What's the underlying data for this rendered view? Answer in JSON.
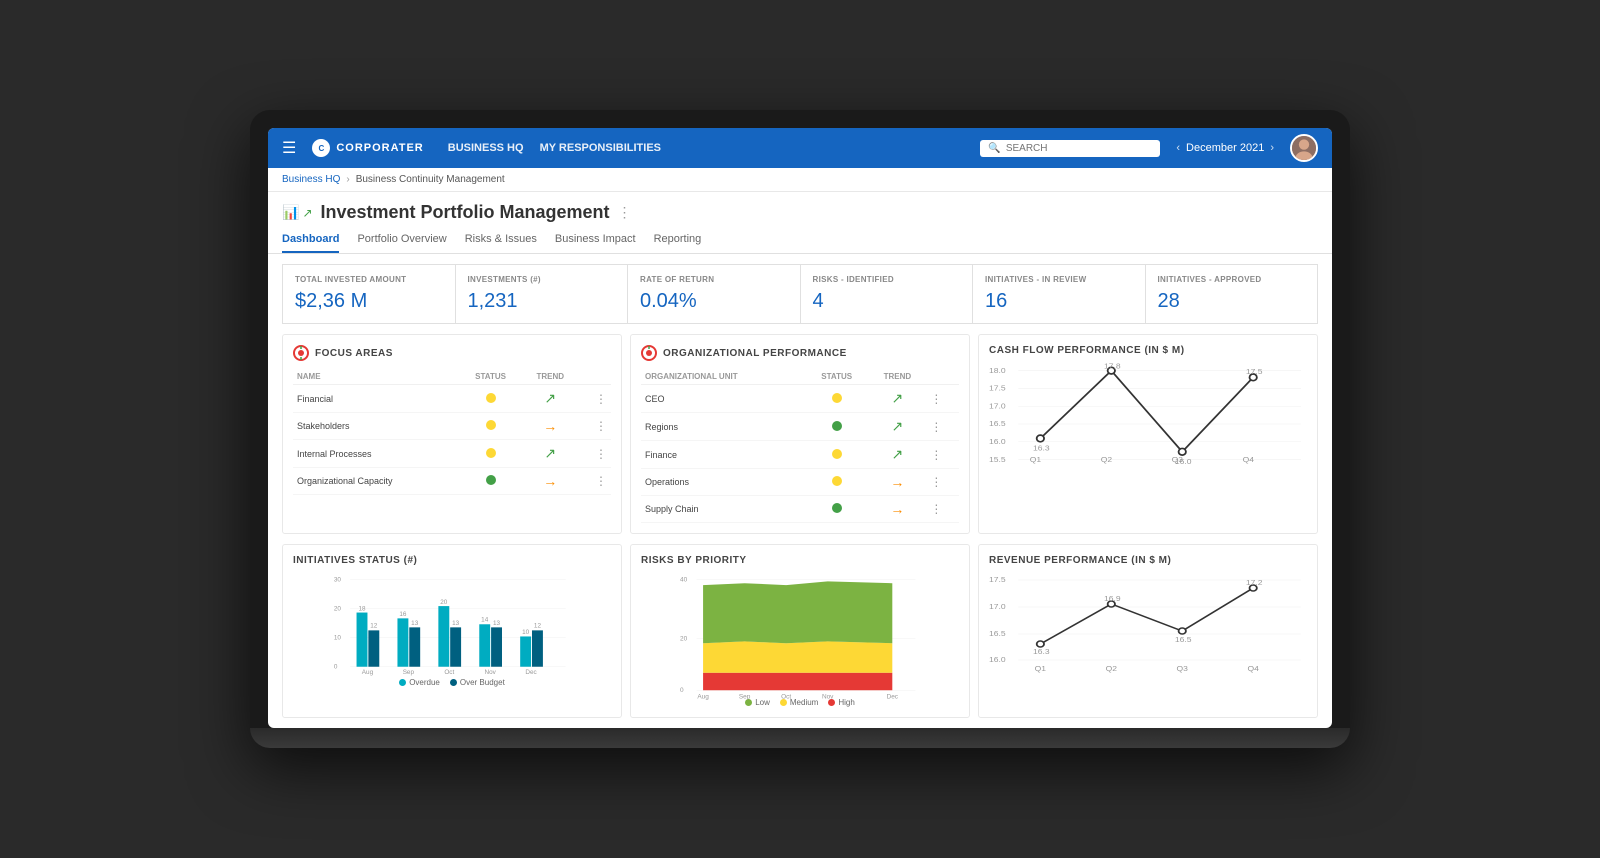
{
  "nav": {
    "hamburger": "☰",
    "logo_text": "CORPORATER",
    "links": [
      "BUSINESS HQ",
      "MY RESPONSIBILITIES"
    ],
    "search_placeholder": "SEARCH",
    "date": "December 2021",
    "prev_arrow": "‹",
    "next_arrow": "›"
  },
  "breadcrumb": {
    "root": "Business HQ",
    "sep": "›",
    "current": "Business Continuity Management"
  },
  "page": {
    "title": "Investment Portfolio Management",
    "more": "⋮"
  },
  "tabs": [
    {
      "label": "Dashboard",
      "active": true
    },
    {
      "label": "Portfolio Overview",
      "active": false
    },
    {
      "label": "Risks & Issues",
      "active": false
    },
    {
      "label": "Business Impact",
      "active": false
    },
    {
      "label": "Reporting",
      "active": false
    }
  ],
  "kpi_cards": [
    {
      "label": "TOTAL INVESTED AMOUNT",
      "value": "$2,36 M"
    },
    {
      "label": "INVESTMENTS (#)",
      "value": "1,231"
    },
    {
      "label": "RATE OF RETURN",
      "value": "0.04%"
    },
    {
      "label": "RISKS - IDENTIFIED",
      "value": "4"
    },
    {
      "label": "INITIATIVES - IN REVIEW",
      "value": "16"
    },
    {
      "label": "INITIATIVES - APPROVED",
      "value": "28"
    }
  ],
  "focus_areas": {
    "title": "FOCUS AREAS",
    "columns": [
      "NAME",
      "STATUS",
      "TREND"
    ],
    "rows": [
      {
        "name": "Financial",
        "status": "yellow",
        "trend": "up"
      },
      {
        "name": "Stakeholders",
        "status": "yellow",
        "trend": "right"
      },
      {
        "name": "Internal Processes",
        "status": "yellow",
        "trend": "up"
      },
      {
        "name": "Organizational Capacity",
        "status": "green",
        "trend": "right"
      }
    ]
  },
  "org_performance": {
    "title": "ORGANIZATIONAL PERFORMANCE",
    "columns": [
      "ORGANIZATIONAL UNIT",
      "STATUS",
      "TREND"
    ],
    "rows": [
      {
        "name": "CEO",
        "status": "yellow",
        "trend": "up"
      },
      {
        "name": "Regions",
        "status": "green",
        "trend": "up"
      },
      {
        "name": "Finance",
        "status": "yellow",
        "trend": "up"
      },
      {
        "name": "Operations",
        "status": "yellow",
        "trend": "right"
      },
      {
        "name": "Supply Chain",
        "status": "green",
        "trend": "right"
      }
    ]
  },
  "cash_flow": {
    "title": "CASH FLOW PERFORMANCE (IN $ M)",
    "y_labels": [
      "18.0",
      "17.5",
      "17.0",
      "16.5",
      "16.0",
      "15.5"
    ],
    "x_labels": [
      "Q1",
      "Q2",
      "Q3",
      "Q4"
    ],
    "points": [
      {
        "x": 0.1,
        "y": 0.6,
        "label": "16.3"
      },
      {
        "x": 0.37,
        "y": 0.05,
        "label": "17.8"
      },
      {
        "x": 0.63,
        "y": 0.75,
        "label": "16.0"
      },
      {
        "x": 0.9,
        "y": 0.1,
        "label": "17.5"
      }
    ]
  },
  "initiatives_status": {
    "title": "INITIATIVES STATUS (#)",
    "y_max": 30,
    "x_labels": [
      "Aug",
      "Sep",
      "Oct",
      "Nov",
      "Dec"
    ],
    "series": [
      {
        "label": "Overdue",
        "color": "#00acc1"
      },
      {
        "label": "Over Budget",
        "color": "#006080"
      }
    ],
    "bars": [
      {
        "month": "Aug",
        "overdue": 18,
        "overbudget": 12
      },
      {
        "month": "Sep",
        "overdue": 16,
        "overbudget": 13
      },
      {
        "month": "Oct",
        "overdue": 20,
        "overbudget": 13
      },
      {
        "month": "Nov",
        "overdue": 14,
        "overbudget": 13
      },
      {
        "month": "Dec",
        "overdue": 10,
        "overbudget": 12
      }
    ]
  },
  "risks_priority": {
    "title": "RISKS BY PRIORITY",
    "y_max": 40,
    "x_labels": [
      "Aug",
      "Sep",
      "Oct",
      "Nov",
      "Dec"
    ],
    "legend": [
      {
        "label": "Low",
        "color": "#7cb342"
      },
      {
        "label": "Medium",
        "color": "#fdd835"
      },
      {
        "label": "High",
        "color": "#e53935"
      }
    ]
  },
  "revenue_performance": {
    "title": "REVENUE PERFORMANCE (IN $ M)",
    "y_labels": [
      "17.5",
      "17.0",
      "16.5",
      "16.0"
    ],
    "x_labels": [
      "Q1",
      "Q2",
      "Q3",
      "Q4"
    ],
    "points": [
      {
        "x": 0.1,
        "y": 0.75,
        "label": "16.3"
      },
      {
        "x": 0.37,
        "y": 0.2,
        "label": "16.9"
      },
      {
        "x": 0.63,
        "y": 0.7,
        "label": "16.5"
      },
      {
        "x": 0.9,
        "y": 0.05,
        "label": "17.2"
      }
    ]
  }
}
